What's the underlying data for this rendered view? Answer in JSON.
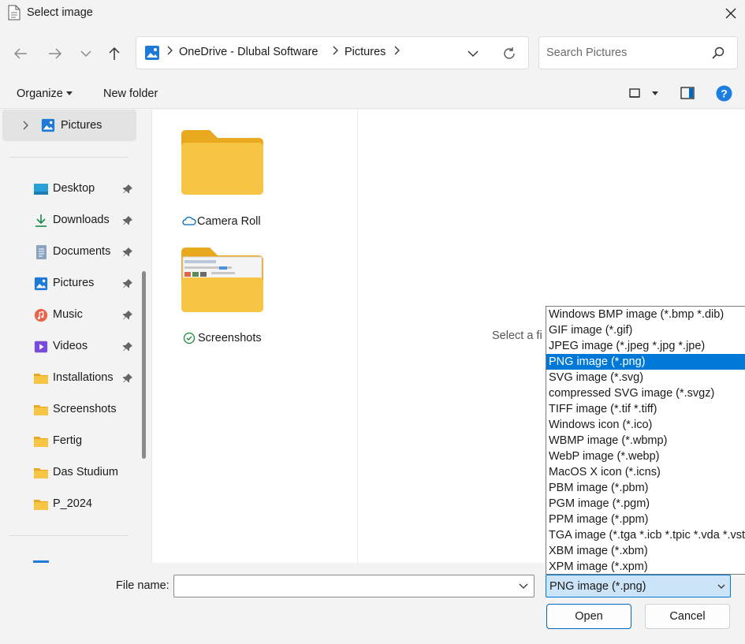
{
  "window": {
    "title": "Select image"
  },
  "address": {
    "segments": [
      "OneDrive - Dlubal Software",
      "Pictures"
    ]
  },
  "search": {
    "placeholder": "Search Pictures"
  },
  "commands": {
    "organize": "Organize",
    "new_folder": "New folder"
  },
  "sidebar": {
    "tree_item": "Pictures",
    "quick_access": [
      {
        "label": "Desktop",
        "icon": "desktop-icon",
        "pinned": true
      },
      {
        "label": "Downloads",
        "icon": "download-icon",
        "pinned": true
      },
      {
        "label": "Documents",
        "icon": "documents-icon",
        "pinned": true
      },
      {
        "label": "Pictures",
        "icon": "pictures-icon",
        "pinned": true
      },
      {
        "label": "Music",
        "icon": "music-icon",
        "pinned": true
      },
      {
        "label": "Videos",
        "icon": "videos-icon",
        "pinned": true
      },
      {
        "label": "Installations",
        "icon": "folder-icon",
        "pinned": true
      },
      {
        "label": "Screenshots",
        "icon": "folder-icon",
        "pinned": false
      },
      {
        "label": "Fertig",
        "icon": "folder-icon",
        "pinned": false
      },
      {
        "label": "Das Studium",
        "icon": "folder-icon",
        "pinned": false
      },
      {
        "label": "P_2024",
        "icon": "folder-icon",
        "pinned": false
      }
    ]
  },
  "files": [
    {
      "name": "Camera Roll",
      "status": "cloud-icon"
    },
    {
      "name": "Screenshots",
      "status": "synced-check-icon"
    }
  ],
  "preview": {
    "text": "Select a fi"
  },
  "bottom": {
    "file_name_label": "File name:",
    "file_name_value": "",
    "file_type_selected": "PNG image (*.png)",
    "open_label": "Open",
    "cancel_label": "Cancel"
  },
  "file_types": [
    "Windows BMP image (*.bmp *.dib)",
    "GIF image (*.gif)",
    "JPEG image (*.jpeg *.jpg *.jpe)",
    "PNG image (*.png)",
    "SVG image (*.svg)",
    "compressed SVG image (*.svgz)",
    "TIFF image (*.tif *.tiff)",
    "Windows icon (*.ico)",
    "WBMP image (*.wbmp)",
    "WebP image (*.webp)",
    "MacOS X icon (*.icns)",
    "PBM image (*.pbm)",
    "PGM image (*.pgm)",
    "PPM image (*.ppm)",
    "TGA image (*.tga *.icb *.tpic *.vda *.vst)",
    "XBM image (*.xbm)",
    "XPM image (*.xpm)"
  ],
  "file_types_selected_index": 3,
  "colors": {
    "accent": "#0078d7",
    "folder": "#f8c443",
    "folder_dark": "#e8a91e"
  }
}
